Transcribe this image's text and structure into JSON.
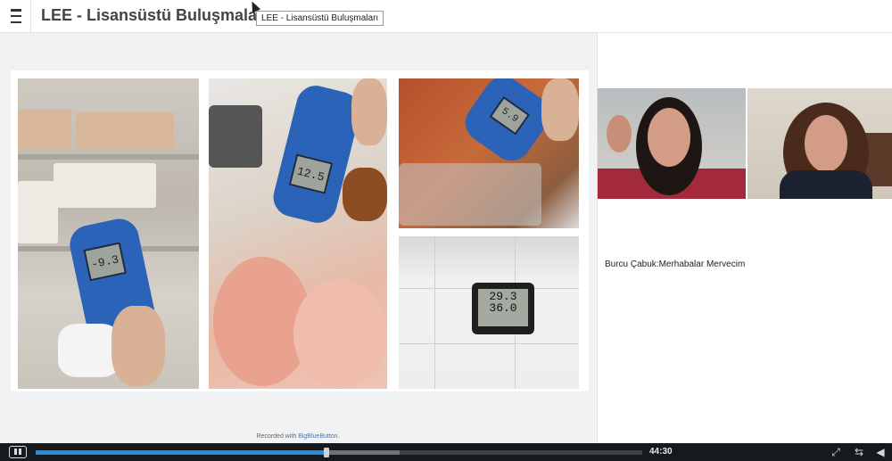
{
  "header": {
    "menu_icon": "hamburger-menu-icon",
    "title": "LEE - Lisansüstü Buluşmaları",
    "tooltip": "LEE - Lisansüstü Buluşmaları"
  },
  "slide": {
    "photos": [
      {
        "reading": "-9.3"
      },
      {
        "reading": "12.5"
      },
      {
        "reading": "5.9"
      },
      {
        "reading_top": "29.3",
        "reading_bottom": "36.0"
      }
    ],
    "recorded_prefix": "Recorded with ",
    "recorded_brand": "BigBlueButton."
  },
  "right_panel": {
    "chat_message": "Burcu Çabuk:Merhabalar Mervecim"
  },
  "player": {
    "time": "44:30",
    "progress_fraction": 0.48,
    "buffer_fraction": 0.6,
    "play_icon": "pause-icon",
    "fullscreen_icon": "fullscreen-icon",
    "swap_icon": "swap-layout-icon",
    "volume_icon": "volume-icon"
  }
}
